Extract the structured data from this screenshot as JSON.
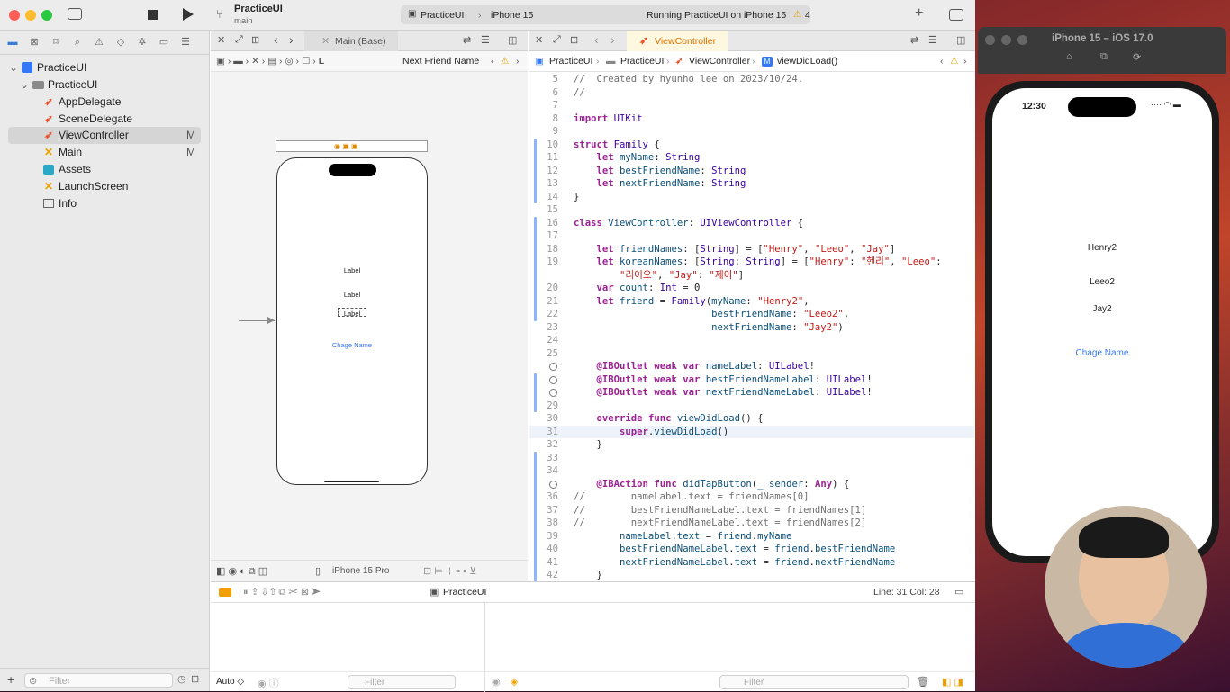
{
  "toolbar": {
    "project": "PracticeUI",
    "branch": "main",
    "scheme": "PracticeUI",
    "device": "iPhone 15",
    "status": "Running PracticeUI on iPhone 15",
    "warnings": "4"
  },
  "navigator": {
    "items": [
      {
        "label": "PracticeUI",
        "badge": ""
      },
      {
        "label": "PracticeUI",
        "badge": ""
      },
      {
        "label": "AppDelegate",
        "badge": ""
      },
      {
        "label": "SceneDelegate",
        "badge": ""
      },
      {
        "label": "ViewController",
        "badge": "M"
      },
      {
        "label": "Main",
        "badge": "M"
      },
      {
        "label": "Assets",
        "badge": ""
      },
      {
        "label": "LaunchScreen",
        "badge": ""
      },
      {
        "label": "Info",
        "badge": ""
      }
    ],
    "filter_placeholder": "Filter"
  },
  "ib": {
    "tab": "Main (Base)",
    "jump_last": "Next Friend Name",
    "labels": [
      "Label",
      "Label",
      "Label"
    ],
    "button": "Chage Name",
    "device": "iPhone 15 Pro"
  },
  "editor": {
    "tab": "ViewController",
    "jump": [
      "PracticeUI",
      "PracticeUI",
      "ViewController",
      "viewDidLoad()"
    ],
    "cursor": "Line: 31  Col: 28"
  },
  "code": [
    {
      "n": "5",
      "t": "//  Created by hyunho lee on 2023/10/24."
    },
    {
      "n": "6",
      "t": "//"
    },
    {
      "n": "7",
      "t": ""
    },
    {
      "n": "8",
      "t": "import UIKit"
    },
    {
      "n": "9",
      "t": ""
    },
    {
      "n": "10",
      "t": "struct Family {"
    },
    {
      "n": "11",
      "t": "    let myName: String"
    },
    {
      "n": "12",
      "t": "    let bestFriendName: String"
    },
    {
      "n": "13",
      "t": "    let nextFriendName: String"
    },
    {
      "n": "14",
      "t": "}"
    },
    {
      "n": "15",
      "t": ""
    },
    {
      "n": "16",
      "t": "class ViewController: UIViewController {"
    },
    {
      "n": "17",
      "t": ""
    },
    {
      "n": "18",
      "t": "    let friendNames: [String] = [\"Henry\", \"Leeo\", \"Jay\"]"
    },
    {
      "n": "19",
      "t": "    let koreanNames: [String: String] = [\"Henry\": \"헨리\", \"Leeo\":"
    },
    {
      "n": "",
      "t": "        \"리이오\", \"Jay\": \"제이\"]"
    },
    {
      "n": "20",
      "t": "    var count: Int = 0"
    },
    {
      "n": "21",
      "t": "    let friend = Family(myName: \"Henry2\","
    },
    {
      "n": "22",
      "t": "                        bestFriendName: \"Leeo2\","
    },
    {
      "n": "23",
      "t": "                        nextFriendName: \"Jay2\")"
    },
    {
      "n": "24",
      "t": ""
    },
    {
      "n": "25",
      "t": ""
    },
    {
      "n": "26",
      "t": "    @IBOutlet weak var nameLabel: UILabel!"
    },
    {
      "n": "27",
      "t": "    @IBOutlet weak var bestFriendNameLabel: UILabel!"
    },
    {
      "n": "28",
      "t": "    @IBOutlet weak var nextFriendNameLabel: UILabel!"
    },
    {
      "n": "29",
      "t": ""
    },
    {
      "n": "30",
      "t": "    override func viewDidLoad() {"
    },
    {
      "n": "31",
      "t": "        super.viewDidLoad()"
    },
    {
      "n": "32",
      "t": "    }"
    },
    {
      "n": "33",
      "t": ""
    },
    {
      "n": "34",
      "t": ""
    },
    {
      "n": "35",
      "t": "    @IBAction func didTapButton(_ sender: Any) {"
    },
    {
      "n": "36",
      "t": "//        nameLabel.text = friendNames[0]"
    },
    {
      "n": "37",
      "t": "//        bestFriendNameLabel.text = friendNames[1]"
    },
    {
      "n": "38",
      "t": "//        nextFriendNameLabel.text = friendNames[2]"
    },
    {
      "n": "39",
      "t": "        nameLabel.text = friend.myName"
    },
    {
      "n": "40",
      "t": "        bestFriendNameLabel.text = friend.bestFriendName"
    },
    {
      "n": "41",
      "t": "        nextFriendNameLabel.text = friend.nextFriendName"
    },
    {
      "n": "42",
      "t": "    }"
    }
  ],
  "debug": {
    "target": "PracticeUI",
    "auto": "Auto ◇",
    "filter": "Filter"
  },
  "simulator": {
    "title": "iPhone 15 – iOS 17.0",
    "time": "12:30",
    "labels": [
      "Henry2",
      "Leeo2",
      "Jay2"
    ],
    "button": "Chage Name"
  }
}
